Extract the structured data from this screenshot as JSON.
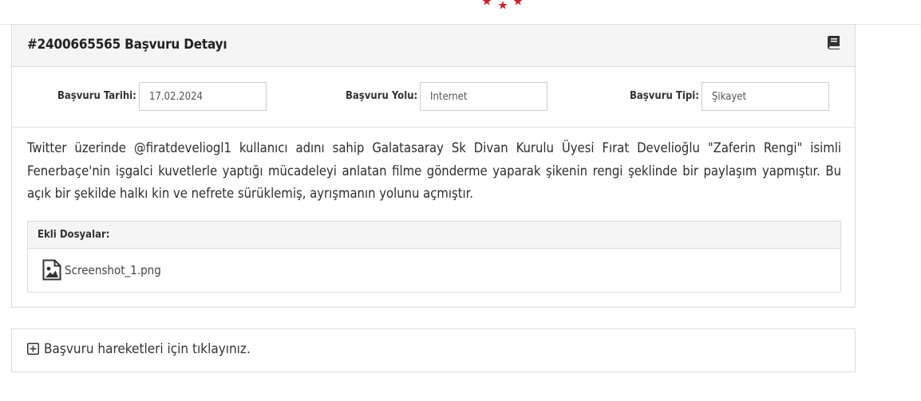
{
  "header": {
    "logo_icon": "stars-icon",
    "accent": "#d0202a"
  },
  "application": {
    "title": "#2400665565 Başvuru Detayı",
    "title_icon": "book-icon",
    "fields": {
      "date_label": "Başvuru Tarihi:",
      "date_value": "17.02.2024",
      "channel_label": "Başvuru Yolu:",
      "channel_value": "İnternet",
      "type_label": "Başvuru Tipi:",
      "type_value": "Şikayet"
    },
    "description": "Twitter üzerinde @firatdeveliogl1 kullanıcı adını sahip Galatasaray Sk Divan Kurulu Üyesi Fırat Develioğlu \"Zaferin Rengi\" isimli Fenerbaçe'nin işgalci kuvetlerle yaptığı mücadeleyi anlatan filme gönderme yaparak şikenin rengi şeklinde bir paylaşım yapmıştır. Bu açık bir şekilde halkı kin ve nefrete sürüklemiş, ayrışmanın yolunu açmıştır.",
    "attachments": {
      "header": "Ekli Dosyalar:",
      "files": [
        {
          "name": "Screenshot_1.png",
          "icon": "image-file-icon"
        }
      ]
    }
  },
  "history": {
    "toggle_icon": "plus-square-icon",
    "toggle_label": "Başvuru hareketleri için tıklayınız."
  }
}
